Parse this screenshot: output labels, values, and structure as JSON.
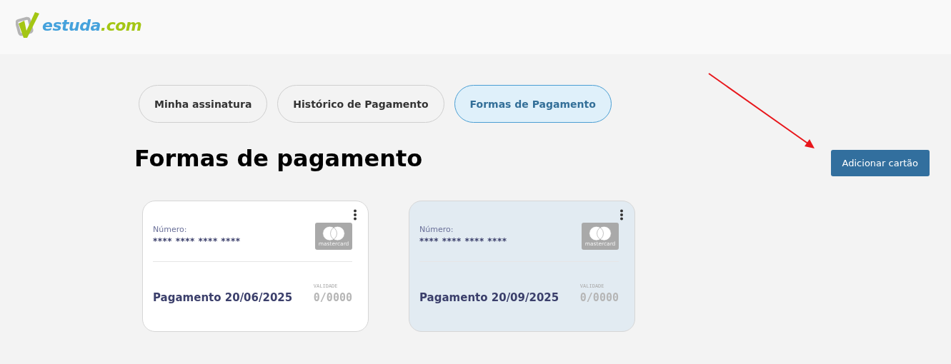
{
  "logo": {
    "name": "estuda",
    "suffix": ".com"
  },
  "tabs": [
    {
      "label": "Minha assinatura",
      "selected": false
    },
    {
      "label": "Histórico de Pagamento",
      "selected": false
    },
    {
      "label": "Formas de Pagamento",
      "selected": true
    }
  ],
  "heading": "Formas de pagamento",
  "add_button": "Adicionar cartão",
  "cards": [
    {
      "number_label": "Número:",
      "number": "**** **** **** ****",
      "brand": "mastercard",
      "payment": "Pagamento 20/06/2025",
      "expiry_label": "VALIDADE",
      "expiry": "0/0000",
      "selected": false
    },
    {
      "number_label": "Número:",
      "number": "**** **** **** ****",
      "brand": "mastercard",
      "payment": "Pagamento 20/09/2025",
      "expiry_label": "VALIDADE",
      "expiry": "0/0000",
      "selected": true
    }
  ]
}
